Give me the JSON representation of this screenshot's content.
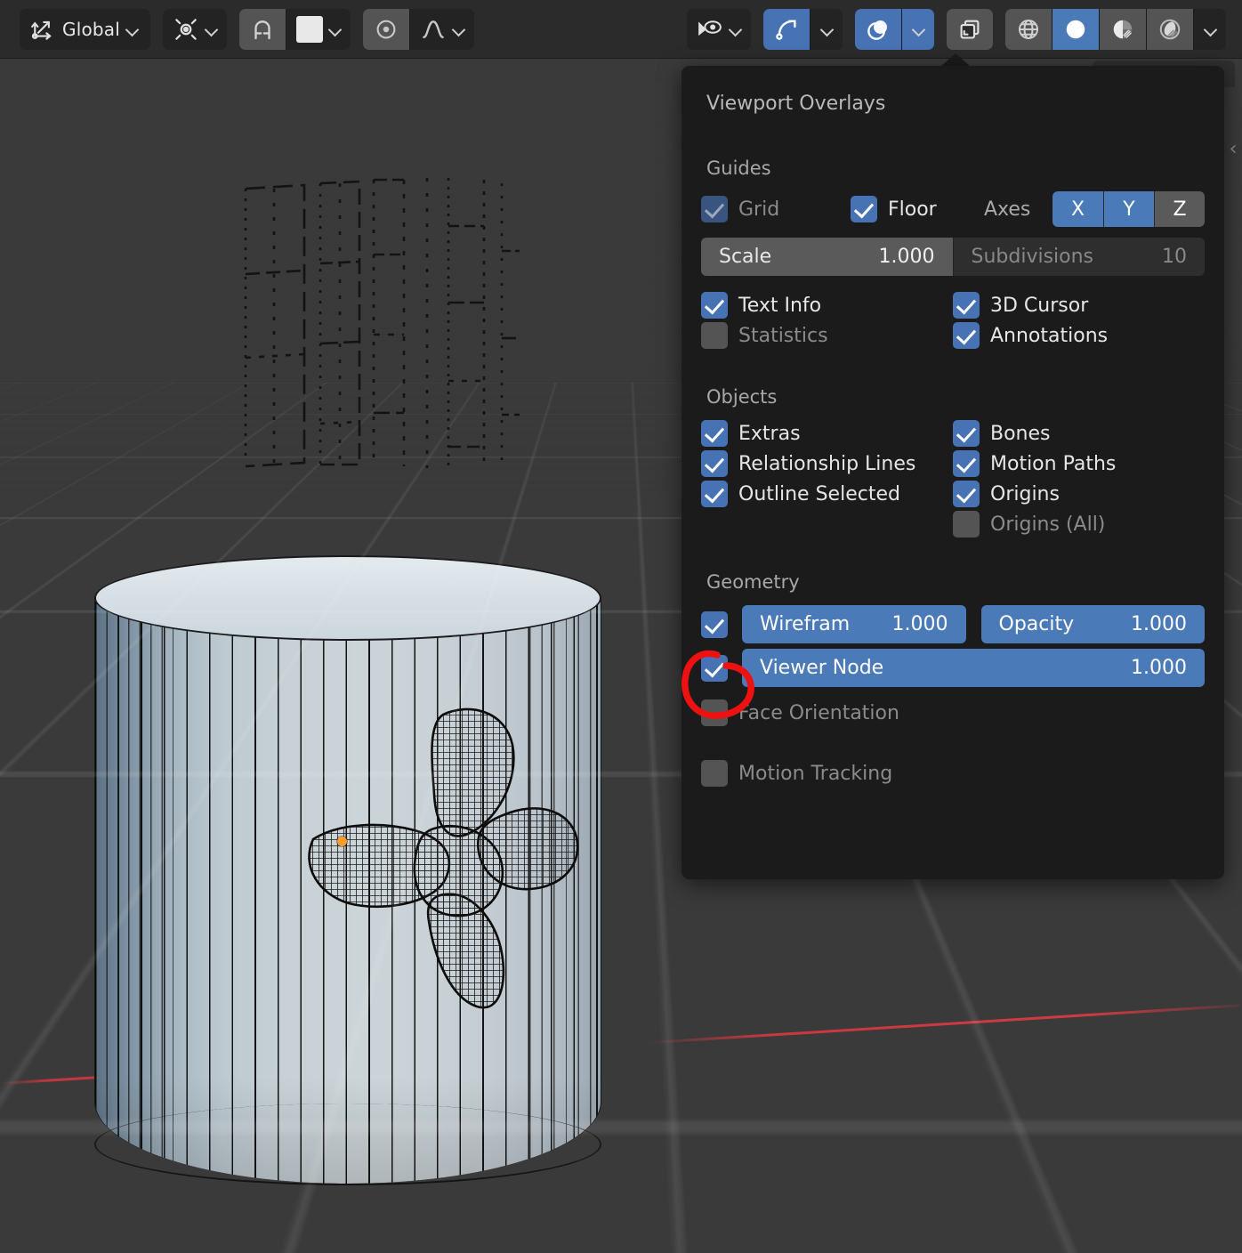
{
  "header": {
    "transform_orientation": {
      "icon": "transform-axes-icon",
      "label": "Global",
      "chevron": "chevron-down-icon"
    },
    "pivot_point": {
      "icon": "pivot-point-icon",
      "chevron": "chevron-down-icon"
    },
    "snapping": {
      "icon": "magnet-icon",
      "swatch": "snap-target-swatch",
      "chevron": "chevron-down-icon"
    },
    "proportional_editing": {
      "icon": "proportional-edit-icon",
      "falloff_icon": "falloff-curve-icon",
      "chevron": "chevron-down-icon"
    },
    "visibility": {
      "icon": "object-visibility-icon",
      "chevron": "chevron-down-icon"
    },
    "gizmos": {
      "icon": "gizmo-icon",
      "chevron": "chevron-down-icon"
    },
    "overlays": {
      "icon": "overlays-icon",
      "chevron": "chevron-down-icon"
    },
    "xray": {
      "icon": "xray-toggle-icon"
    },
    "shading_modes": [
      {
        "name": "wireframe-shading",
        "icon": "wireframe-globe-icon",
        "active": false
      },
      {
        "name": "solid-shading",
        "icon": "solid-sphere-icon",
        "active": true
      },
      {
        "name": "material-preview-shading",
        "icon": "material-preview-icon",
        "active": false
      },
      {
        "name": "rendered-shading",
        "icon": "rendered-sphere-icon",
        "active": false
      }
    ],
    "shading_chevron": "chevron-down-icon",
    "sidebar_toggle": "‹"
  },
  "overlays_panel": {
    "title": "Viewport Overlays",
    "sections": {
      "guides": {
        "heading": "Guides",
        "grid": {
          "label": "Grid",
          "checked": true,
          "enabled": false
        },
        "floor": {
          "label": "Floor",
          "checked": true,
          "enabled": true
        },
        "axes_label": "Axes",
        "axes": [
          {
            "label": "X",
            "active": true
          },
          {
            "label": "Y",
            "active": true
          },
          {
            "label": "Z",
            "active": false
          }
        ],
        "scale": {
          "label": "Scale",
          "value": "1.000"
        },
        "subdivisions": {
          "label": "Subdivisions",
          "value": "10",
          "enabled": false
        },
        "text_info": {
          "label": "Text Info",
          "checked": true
        },
        "cursor_3d": {
          "label": "3D Cursor",
          "checked": true
        },
        "statistics": {
          "label": "Statistics",
          "checked": false
        },
        "annotations": {
          "label": "Annotations",
          "checked": true
        }
      },
      "objects": {
        "heading": "Objects",
        "extras": {
          "label": "Extras",
          "checked": true
        },
        "bones": {
          "label": "Bones",
          "checked": true
        },
        "relationship_lines": {
          "label": "Relationship Lines",
          "checked": true
        },
        "motion_paths": {
          "label": "Motion Paths",
          "checked": true
        },
        "outline_selected": {
          "label": "Outline Selected",
          "checked": true
        },
        "origins": {
          "label": "Origins",
          "checked": true
        },
        "origins_all": {
          "label": "Origins (All)",
          "checked": false,
          "enabled": false
        }
      },
      "geometry": {
        "heading": "Geometry",
        "wireframe": {
          "checked": true,
          "label": "Wirefram",
          "value": "1.000"
        },
        "opacity": {
          "label": "Opacity",
          "value": "1.000"
        },
        "viewer_node": {
          "checked": true,
          "label": "Viewer Node",
          "value": "1.000"
        },
        "face_orientation": {
          "label": "Face Orientation",
          "checked": false
        },
        "motion_tracking": {
          "label": "Motion Tracking",
          "checked": false
        }
      }
    }
  },
  "annotation": {
    "shape": "red-circle-highlight",
    "color": "#ee1111",
    "target": "wireframe-checkbox"
  },
  "viewport": {
    "background_color": "#3a3a3a",
    "grid_color": "#4c4c4c",
    "x_axis_color": "#c9383f",
    "object": "cylinder-with-fan-texture",
    "origin_dot_color": "#ff9d2e"
  }
}
